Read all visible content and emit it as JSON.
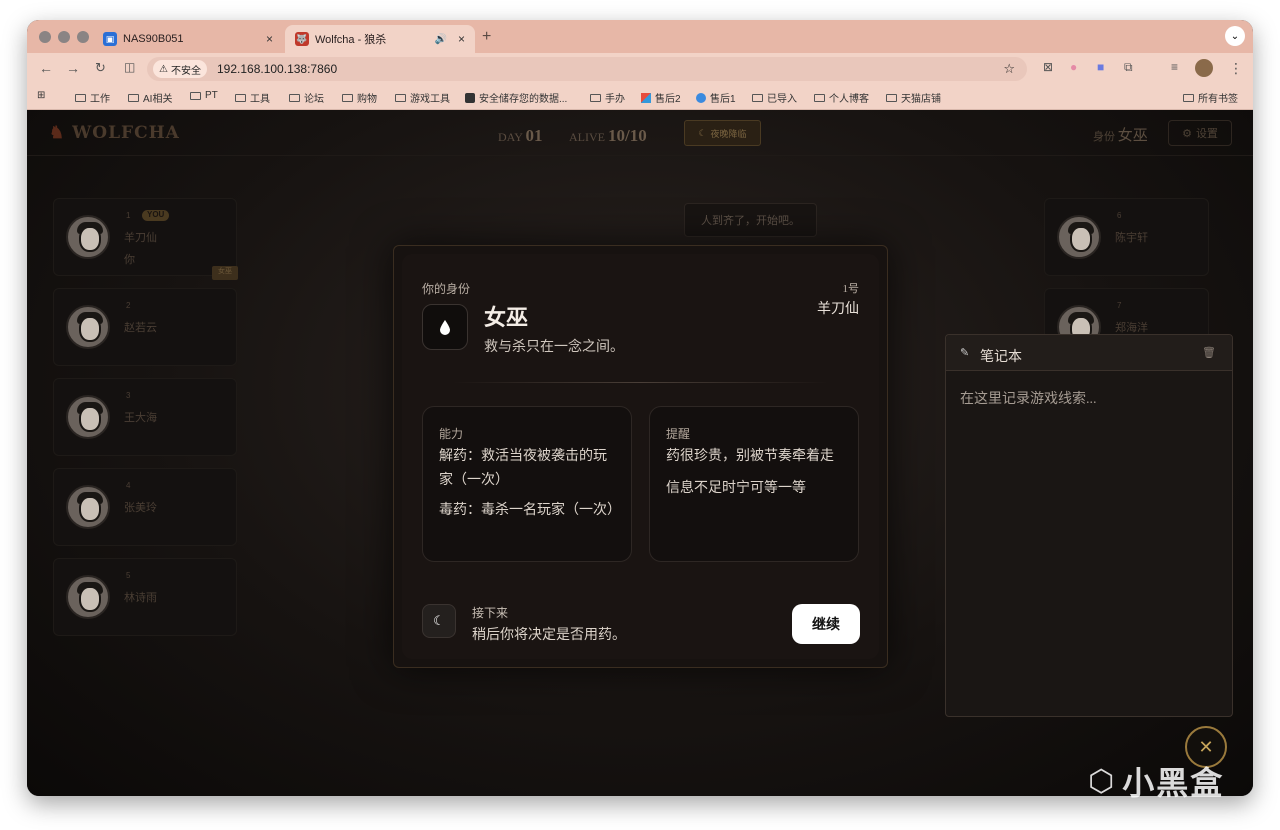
{
  "browser": {
    "tabs": [
      {
        "title": "NAS90B051",
        "active": false
      },
      {
        "title": "Wolfcha - 狼杀",
        "active": true
      }
    ],
    "address": {
      "security_label": "不安全",
      "url": "192.168.100.138:7860"
    },
    "bookmarks": [
      "工作",
      "AI相关",
      "PT",
      "工具",
      "论坛",
      "购物",
      "游戏工具",
      "安全储存您的数据...",
      "手办",
      "售后2",
      "售后1",
      "已导入",
      "个人博客",
      "天猫店铺"
    ],
    "all_bookmarks": "所有书签"
  },
  "app": {
    "logo": "WOLFCHA",
    "day_label": "DAY",
    "day_value": "01",
    "alive_label": "ALIVE",
    "alive_value": "10/10",
    "phase_button": "夜晚降临",
    "identity_label": "身份",
    "identity_value": "女巫",
    "settings_label": "设置"
  },
  "players_left": [
    {
      "num": "1",
      "name": "羊刀仙",
      "you_badge": "YOU",
      "sub": "你",
      "tag": "女巫"
    },
    {
      "num": "2",
      "name": "赵若云"
    },
    {
      "num": "3",
      "name": "王大海"
    },
    {
      "num": "4",
      "name": "张美玲"
    },
    {
      "num": "5",
      "name": "林诗雨"
    }
  ],
  "players_right": [
    {
      "num": "6",
      "name": "陈宇轩"
    },
    {
      "num": "7",
      "name": "郑海洋"
    }
  ],
  "chat": {
    "message": "人到齐了，开始吧。"
  },
  "modal": {
    "label": "你的身份",
    "seat": "1号",
    "player_name": "羊刀仙",
    "role": "女巫",
    "tagline": "救与杀只在一念之间。",
    "ability_title": "能力",
    "abilities": [
      "解药：救活当夜被袭击的玩家（一次）",
      "毒药：毒杀一名玩家（一次）"
    ],
    "tips_title": "提醒",
    "tips": [
      "药很珍贵，别被节奏牵着走",
      "信息不足时宁可等一等"
    ],
    "next_title": "接下来",
    "next_desc": "稍后你将决定是否用药。",
    "continue_label": "继续"
  },
  "notebook": {
    "title": "笔记本",
    "placeholder": "在这里记录游戏线索..."
  },
  "watermark": "小黑盒"
}
